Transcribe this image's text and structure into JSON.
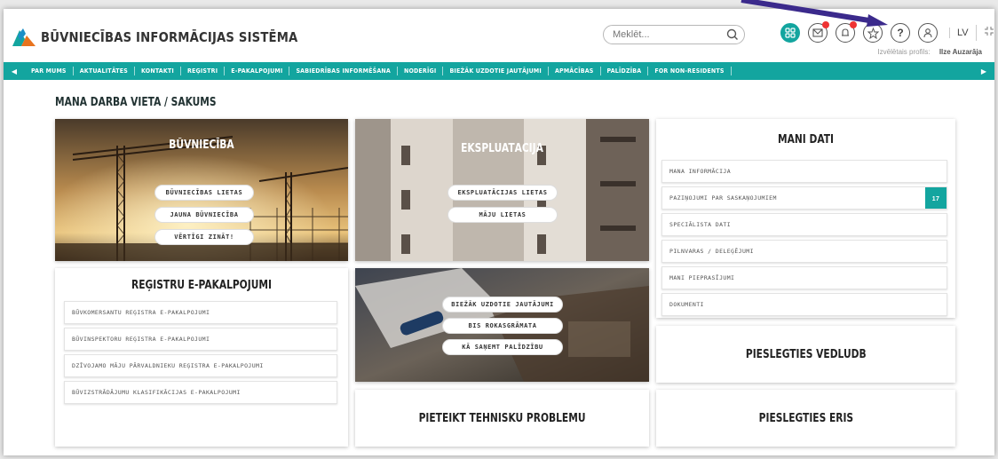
{
  "header": {
    "app_title": "BŪVNIECĪBAS INFORMĀCIJAS SISTĒMA",
    "search_placeholder": "Meklēt...",
    "language": "LV",
    "profile_label": "Izvēlētais profils:",
    "profile_name": "Ilze Auzarāja",
    "icons": [
      "apps-icon",
      "mail-icon",
      "bell-icon",
      "star-icon",
      "help-icon",
      "user-icon",
      "fullscreen-icon"
    ]
  },
  "nav": {
    "items": [
      "PAR MUMS",
      "AKTUALITĀTES",
      "KONTAKTI",
      "REĢISTRI",
      "E-PAKALPOJUMI",
      "SABIEDRĪBAS INFORMĒŠANA",
      "NODERĪGI",
      "BIEŽĀK UZDOTIE JAUTĀJUMI",
      "APMĀCĪBAS",
      "PALĪDZĪBA",
      "FOR NON-RESIDENTS"
    ]
  },
  "page_title": "MANA DARBA VIETA / SĀKUMS",
  "buvnieciba": {
    "title": "BŪVNIECĪBA",
    "buttons": [
      "BŪVNIECĪBAS LIETAS",
      "JAUNA BŪVNIECĪBA",
      "VĒRTĪGI ZINĀT!"
    ]
  },
  "ekspluatacija": {
    "title": "EKSPLUATĀCIJA",
    "buttons": [
      "EKSPLUATĀCIJAS LIETAS",
      "MĀJU LIETAS"
    ]
  },
  "mani_dati": {
    "title": "MANI DATI",
    "items": [
      "MANA INFORMĀCIJA",
      "PAZIŅOJUMI PAR SASKAŅOJUMIEM",
      "SPECIĀLISTA DATI",
      "PILNVARAS / DELEĢĒJUMI",
      "MANI PIEPRASĪJUMI",
      "DOKUMENTI"
    ],
    "notifications_count": "17"
  },
  "registri": {
    "title": "REĢISTRU E-PAKALPOJUMI",
    "items": [
      "BŪVKOMERSANTU REĢISTRA E-PAKALPOJUMI",
      "BŪVINSPEKTORU REĢISTRA E-PAKALPOJUMI",
      "DZĪVOJAMO MĀJU PĀRVALDNIEKU REĢISTRA E-PAKALPOJUMI",
      "BŪVIZSTRĀDĀJUMU KLASIFIKĀCIJAS E-PAKALPOJUMI"
    ]
  },
  "help": {
    "buttons": [
      "BIEŽĀK UZDOTIE JAUTĀJUMI",
      "BIS ROKASGRĀMATA",
      "KĀ SAŅEMT PALĪDZĪBU"
    ]
  },
  "actions": {
    "vedludb": "PIESLĒGTIES VEDLUDB",
    "problem": "PIETEIKT TEHNISKU PROBLĒMU",
    "eris": "PIESLĒGTIES ERIS"
  },
  "colors": {
    "accent": "#13a59f",
    "arrow": "#3b2a8c"
  }
}
